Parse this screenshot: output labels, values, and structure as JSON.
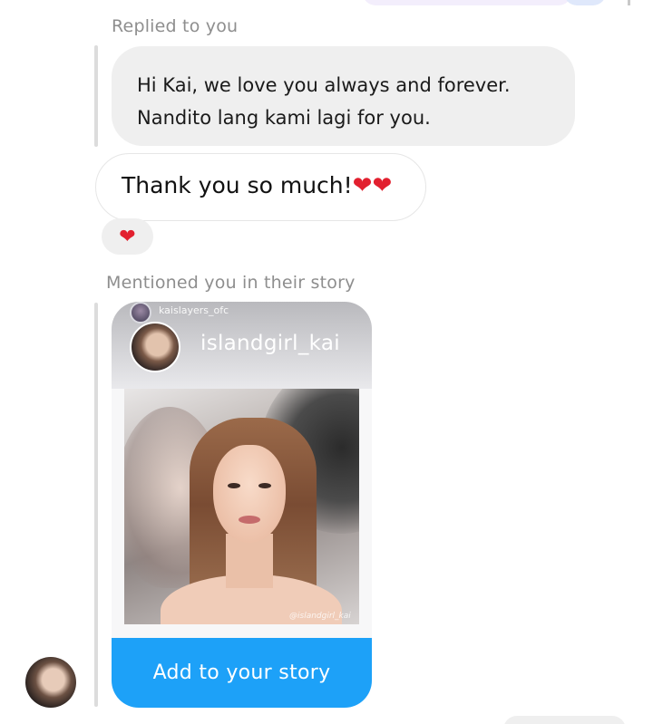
{
  "conversation": {
    "reply": {
      "label": "Replied to you",
      "quoted_lines": [
        "Hi Kai, we love you always and forever.",
        "Nandito lang kami lagi for you."
      ]
    },
    "message": {
      "text": "Thank you so much!",
      "emoji": "❤❤"
    },
    "reaction": {
      "emoji": "❤"
    },
    "story_mention": {
      "label": "Mentioned you in their story",
      "reposter_handle": "kaislayers_ofc",
      "username": "islandgirl_kai",
      "photo_watermark": "@islandgirl_kai",
      "action_label": "Add to your story"
    }
  },
  "colors": {
    "bubble_gray": "#efefef",
    "accent_blue": "#1da1f8",
    "heart_red": "#e2202f",
    "meta_text": "#8e8e8e"
  }
}
